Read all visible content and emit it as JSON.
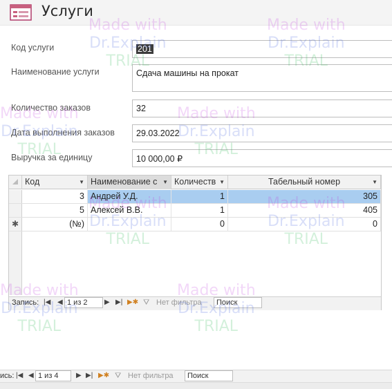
{
  "form": {
    "title": "Услуги",
    "fields": [
      {
        "label": "Код услуги",
        "value": "201"
      },
      {
        "label": "Наименование услуги",
        "value": "Сдача машины на прокат"
      },
      {
        "label": "Количество заказов",
        "value": "32"
      },
      {
        "label": "Дата выполнения заказов",
        "value": "29.03.2022"
      },
      {
        "label": "Выручка за единицу",
        "value": "10 000,00 ₽"
      }
    ]
  },
  "subform": {
    "columns": [
      "Код",
      "Наименование с",
      "Количеств",
      "Табельный номер"
    ],
    "rows": [
      {
        "code": "3",
        "name": "Андрей У.Д.",
        "qty": "1",
        "tab": "305"
      },
      {
        "code": "5",
        "name": "Алексей В.В.",
        "qty": "1",
        "tab": "405"
      }
    ],
    "new_row": {
      "marker": "✱",
      "code": "(№)",
      "name": "",
      "qty": "0",
      "tab": "0"
    },
    "nav": {
      "label": "Запись:",
      "position": "1 из 2",
      "filter": "Нет фильтра",
      "search": "Поиск"
    }
  },
  "main_nav": {
    "label": "ись:",
    "position": "1 из 4",
    "filter": "Нет фильтра",
    "search": "Поиск"
  },
  "icons": {
    "header": "form-icon",
    "nav_first": "first-record-icon",
    "nav_prev": "prev-record-icon",
    "nav_next": "next-record-icon",
    "nav_last": "last-record-icon",
    "nav_new": "new-record-icon",
    "filter": "filter-icon"
  },
  "watermark": {
    "line1": "Made with",
    "line2": "Dr.Explain",
    "line3": "TRIAL"
  },
  "colors": {
    "selected_row": "#a9cdf0",
    "header_bg": "#f4f4f4"
  }
}
